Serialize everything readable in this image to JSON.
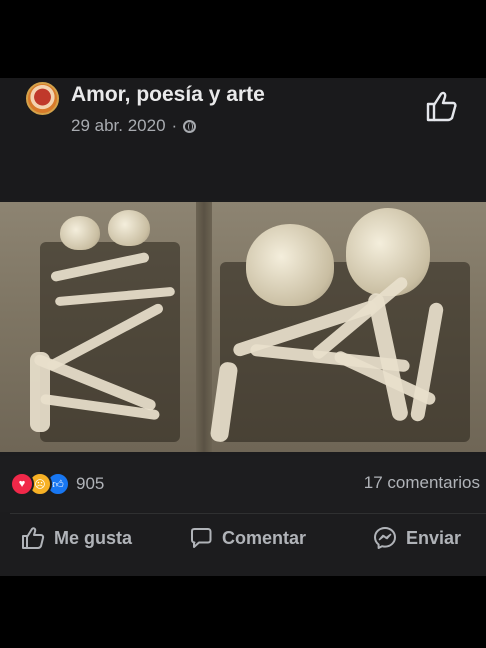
{
  "post": {
    "page_name": "Amor, poesía y arte",
    "date": "29 abr. 2020",
    "separator": "·",
    "privacy_icon": "globe-icon",
    "top_icon": "thumbs-up-outline-icon"
  },
  "reactions": {
    "icons": [
      "love-icon",
      "sad-icon",
      "like-icon"
    ],
    "count": "905"
  },
  "comments": {
    "count_label": "17 comentarios"
  },
  "actions": {
    "like_label": "Me gusta",
    "comment_label": "Comentar",
    "send_label": "Enviar"
  },
  "colors": {
    "background": "#000000",
    "post_background": "#1c1c1e",
    "text_primary": "#e9e9ea",
    "text_secondary": "#b0b3b8",
    "love": "#f02849",
    "sad": "#f7b125",
    "like": "#1877f2"
  }
}
